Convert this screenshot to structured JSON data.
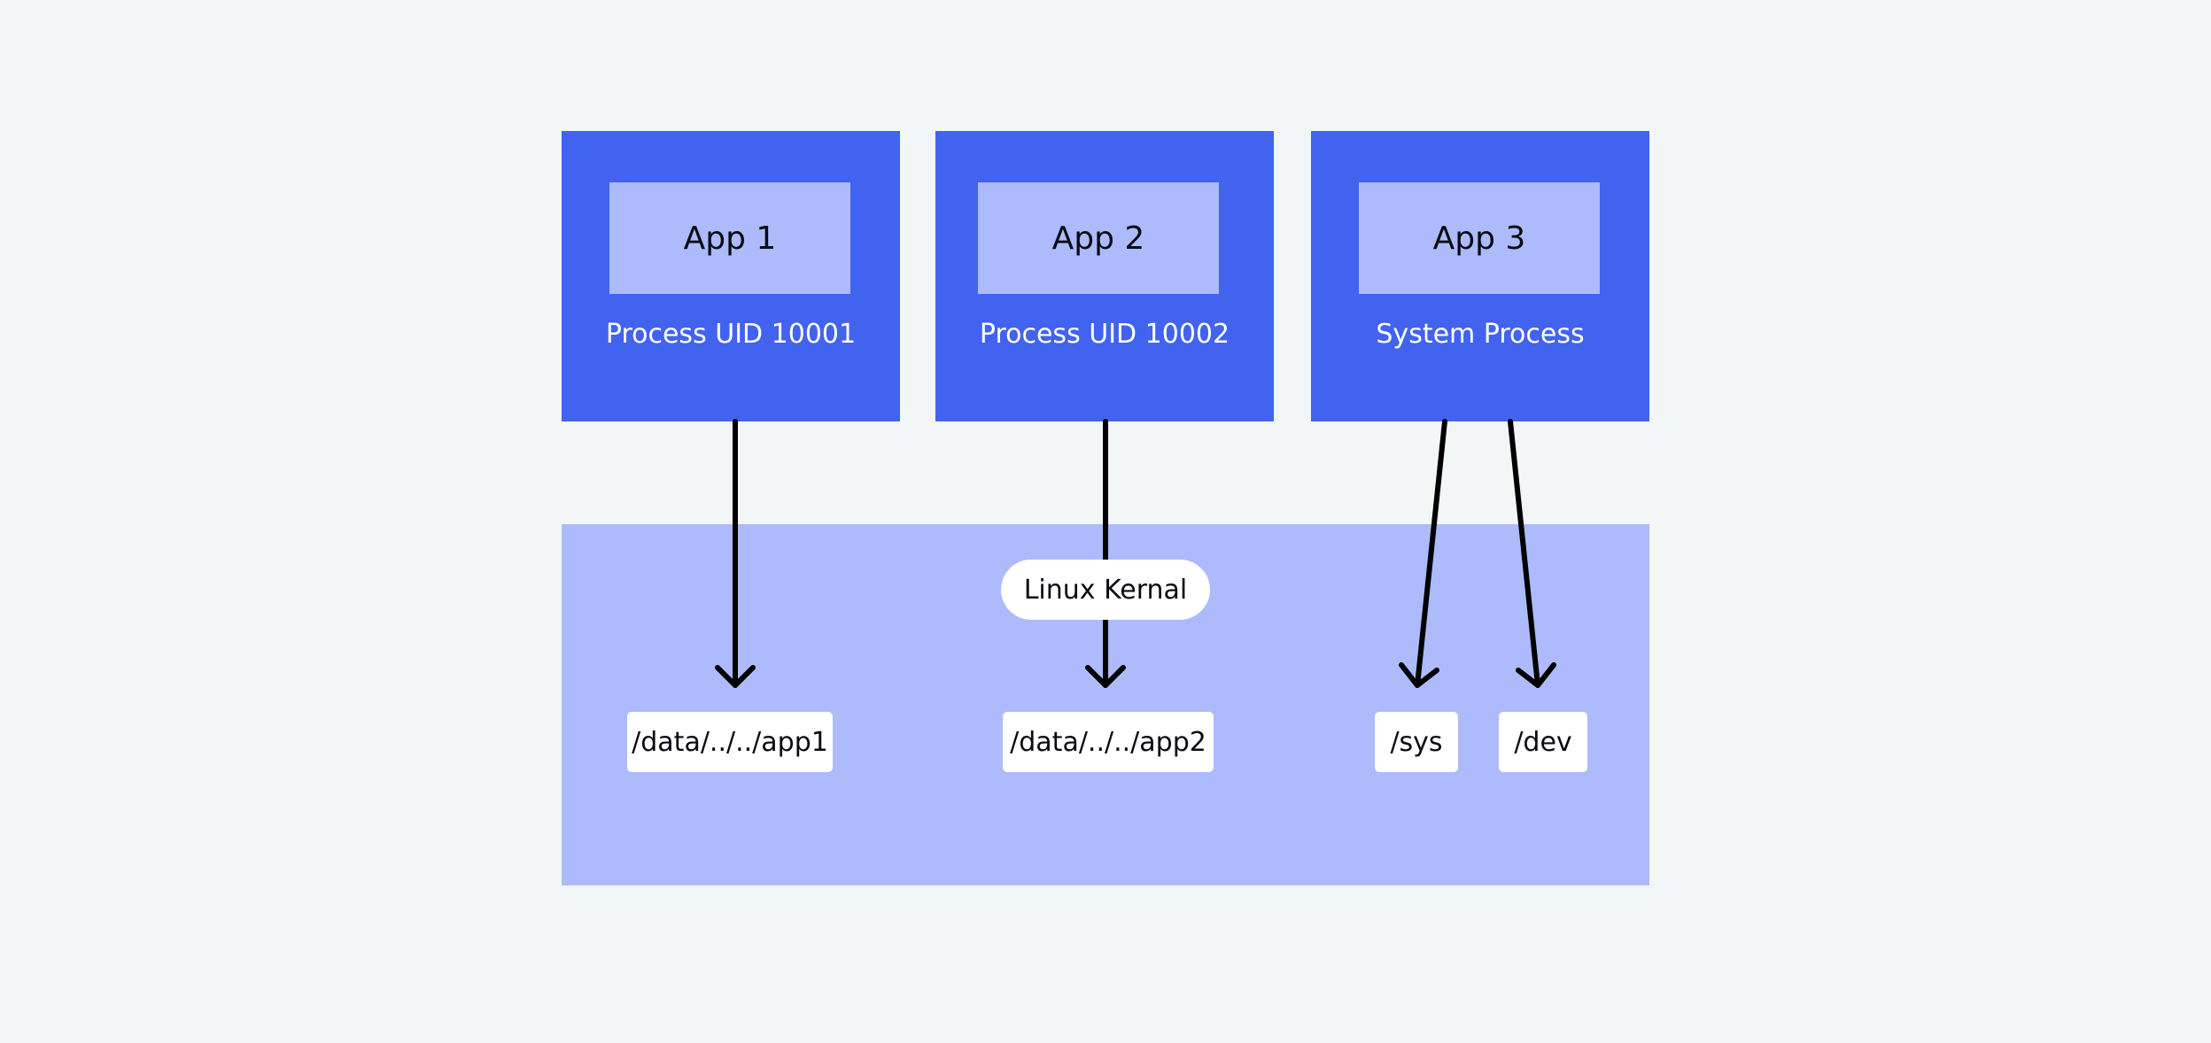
{
  "diagram": {
    "processes": [
      {
        "app": "App 1",
        "label": "Process UID 10001"
      },
      {
        "app": "App 2",
        "label": "Process UID 10002"
      },
      {
        "app": "App 3",
        "label": "System Process"
      }
    ],
    "kernel": {
      "label": "Linux Kernal"
    },
    "paths": [
      "/data/../../app1",
      "/data/../../app2",
      "/sys",
      "/dev"
    ],
    "edges": [
      {
        "from": "App 1",
        "to": "/data/../../app1"
      },
      {
        "from": "App 2",
        "to": "/data/../../app2"
      },
      {
        "from": "App 3",
        "to": "/sys"
      },
      {
        "from": "App 3",
        "to": "/dev"
      }
    ],
    "colors": {
      "background": "#f2f6f7",
      "process_box": "#4263f0",
      "app_box": "#adbbfd",
      "kernel_region": "#adbbfd",
      "label_box": "#ffffff",
      "arrow": "#000000"
    }
  }
}
